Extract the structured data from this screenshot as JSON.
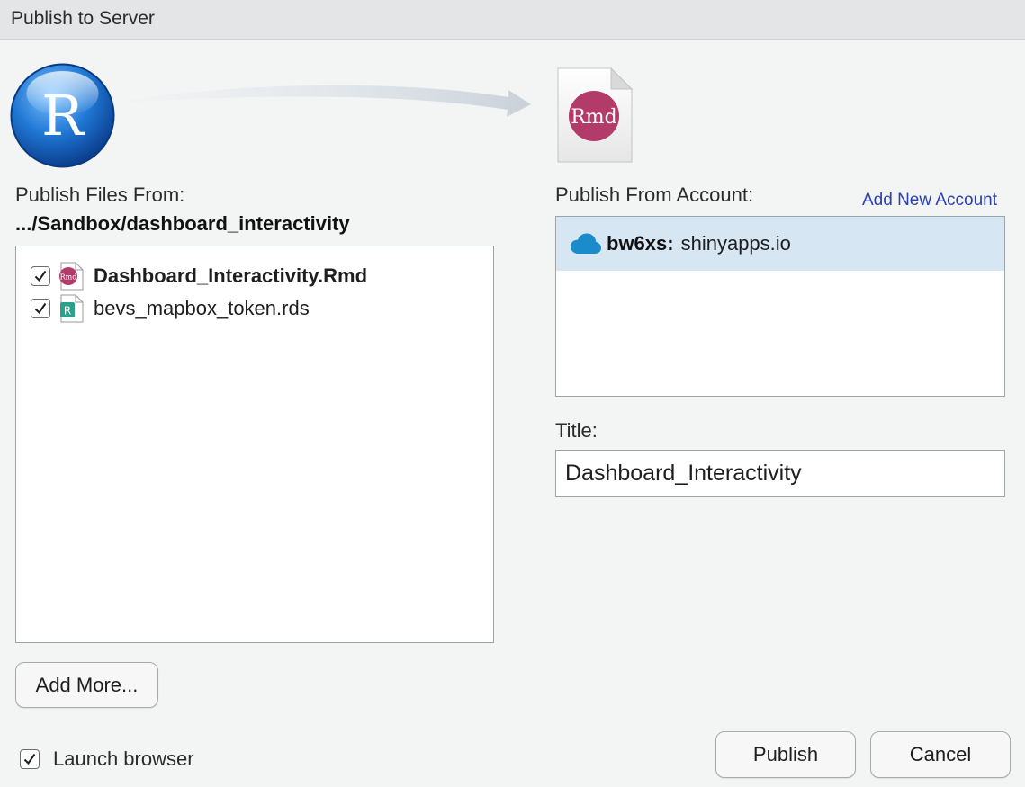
{
  "window": {
    "title": "Publish to Server"
  },
  "source": {
    "label": "Publish Files From:",
    "path": ".../Sandbox/dashboard_interactivity",
    "files": [
      {
        "name": "Dashboard_Interactivity.Rmd",
        "checked": true,
        "type": "rmd"
      },
      {
        "name": "bevs_mapbox_token.rds",
        "checked": true,
        "type": "rds"
      }
    ],
    "add_more_label": "Add More..."
  },
  "account": {
    "label": "Publish From Account:",
    "add_new_label": "Add New Account",
    "selected": {
      "name": "bw6xs:",
      "server": "shinyapps.io"
    }
  },
  "title_field": {
    "label": "Title:",
    "value": "Dashboard_Interactivity"
  },
  "launch_browser": {
    "label": "Launch browser",
    "checked": true
  },
  "buttons": {
    "publish_label": "Publish",
    "cancel_label": "Cancel"
  },
  "icons": {
    "r_logo_text": "R",
    "rmd_badge_text": "Rmd",
    "rds_badge_text": "R",
    "r_logo": "r-logo-icon",
    "rmd_document": "rmd-document-icon",
    "cloud": "cloud-icon",
    "checkbox": "checkmark-icon"
  },
  "colors": {
    "r_logo_blue": "#1f77d4",
    "rmd_badge": "#b33b6a",
    "rds_badge": "#2aa189",
    "cloud": "#1a8ccc",
    "link": "#2a3fb0",
    "selection": "#d7e6f3"
  }
}
